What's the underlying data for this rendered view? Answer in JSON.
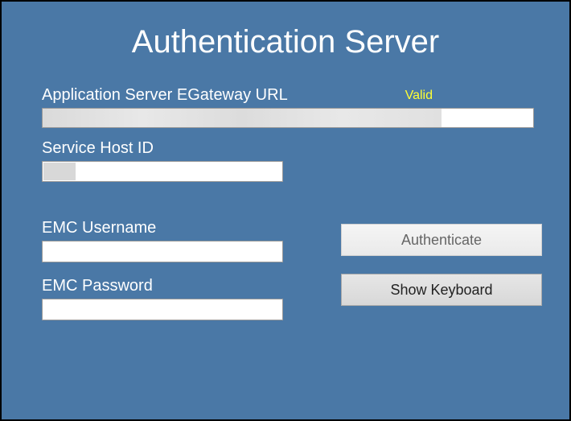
{
  "title": "Authentication Server",
  "fields": {
    "egateway": {
      "label": "Application Server EGateway URL",
      "status": "Valid",
      "value": ""
    },
    "host_id": {
      "label": "Service Host ID",
      "value": ""
    },
    "username": {
      "label": "EMC Username",
      "value": ""
    },
    "password": {
      "label": "EMC Password",
      "value": ""
    }
  },
  "buttons": {
    "authenticate": "Authenticate",
    "show_keyboard": "Show Keyboard"
  }
}
